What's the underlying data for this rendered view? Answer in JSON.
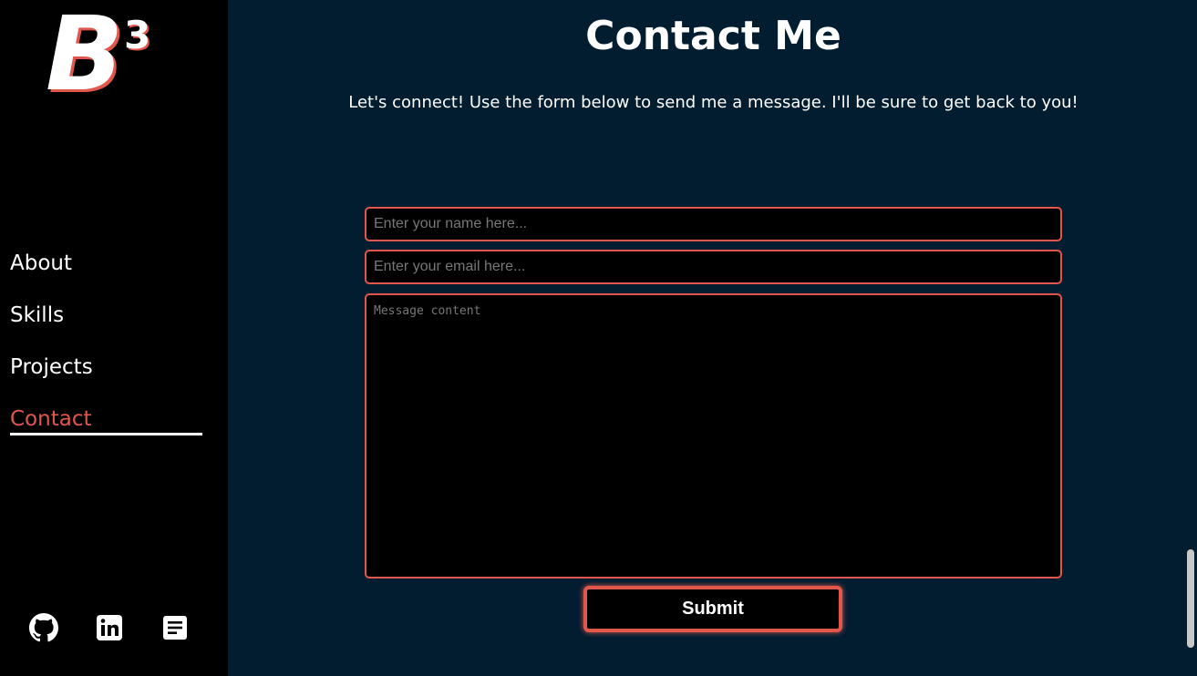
{
  "logo": {
    "letter": "B",
    "superscript": "3"
  },
  "nav": {
    "items": [
      {
        "label": "About"
      },
      {
        "label": "Skills"
      },
      {
        "label": "Projects"
      },
      {
        "label": "Contact"
      }
    ],
    "active": "Contact"
  },
  "socials": [
    "github-icon",
    "linkedin-icon",
    "resume-icon"
  ],
  "contact": {
    "title": "Contact Me",
    "intro": "Let's connect! Use the form below to send me a message. I'll be sure to get back to you!",
    "name_placeholder": "Enter your name here...",
    "email_placeholder": "Enter your email here...",
    "message_placeholder": "Message content",
    "submit_label": "Submit"
  },
  "colors": {
    "accent": "#e2574c",
    "background": "#021d30",
    "sidebar": "#000000",
    "text": "#ffffff"
  }
}
